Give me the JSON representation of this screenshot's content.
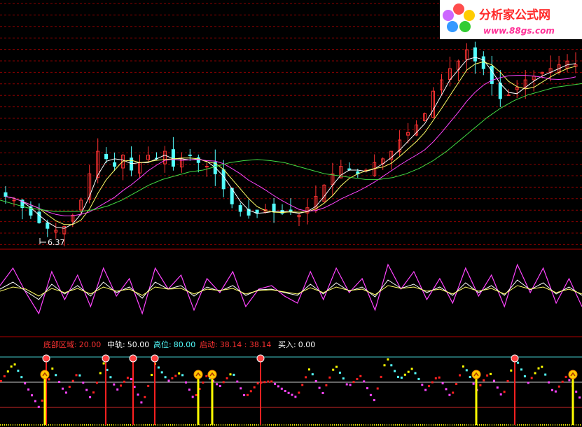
{
  "watermark": {
    "brand": "分析家公式网",
    "url": "www.88gs.com"
  },
  "chart_data": [
    {
      "type": "candlestick",
      "panel": "price",
      "low_label": "6.37",
      "colors": {
        "up": "#ff3232",
        "down": "#54ffff",
        "ma_white": "#ffffff",
        "ma_yellow": "#ffff66",
        "ma_magenta": "#ff44ff",
        "ma_green": "#44dd44"
      },
      "grid": true,
      "close": [
        7.4,
        7.3,
        7.1,
        6.9,
        6.7,
        6.55,
        6.5,
        6.6,
        6.9,
        7.3,
        8.0,
        8.6,
        8.4,
        8.2,
        8.5,
        8.1,
        8.3,
        8.5,
        8.4,
        8.6,
        8.2,
        8.4,
        8.5,
        8.3,
        8.2,
        8.0,
        7.6,
        7.2,
        7.0,
        6.9,
        6.95,
        7.05,
        7.0,
        6.95,
        7.0,
        6.9,
        7.1,
        7.4,
        7.7,
        8.0,
        8.2,
        8.1,
        8.0,
        8.1,
        8.3,
        8.4,
        8.6,
        8.9,
        9.1,
        9.3,
        9.6,
        10.2,
        10.5,
        10.8,
        11.0,
        11.3,
        11.0,
        10.8,
        10.4,
        10.0,
        10.1,
        10.3,
        10.5,
        10.6,
        10.7,
        10.8,
        10.9,
        11.0,
        10.9
      ],
      "ma_green_close": [
        7.3,
        7.2,
        7.1,
        7.05,
        7.0,
        7.0,
        7.0,
        7.05,
        7.15,
        7.3,
        7.5,
        7.7,
        7.85,
        7.95,
        8.05,
        8.1,
        8.2,
        8.3,
        8.35,
        8.38,
        8.35,
        8.3,
        8.2,
        8.1,
        8.0,
        7.95,
        7.9,
        7.85,
        7.85,
        7.9,
        8.0,
        8.15,
        8.35,
        8.6,
        8.9,
        9.2,
        9.5,
        9.75,
        9.95,
        10.1,
        10.2,
        10.3,
        10.35,
        10.4
      ]
    },
    {
      "type": "line",
      "panel": "oscillator",
      "series": [
        {
          "color": "#ff44ff",
          "values": [
            60,
            85,
            50,
            20,
            80,
            40,
            75,
            30,
            85,
            45,
            70,
            20,
            85,
            55,
            75,
            25,
            70,
            50,
            80,
            30,
            55,
            60,
            45,
            35,
            80,
            40,
            85,
            50,
            70,
            25,
            90,
            55,
            80,
            40,
            70,
            35,
            85,
            45,
            75,
            30,
            90,
            50,
            85,
            35,
            70,
            30
          ]
        },
        {
          "color": "#ffffff",
          "values": [
            55,
            65,
            52,
            40,
            62,
            48,
            60,
            45,
            65,
            50,
            58,
            42,
            65,
            55,
            60,
            45,
            58,
            52,
            60,
            46,
            54,
            55,
            50,
            46,
            62,
            48,
            64,
            52,
            58,
            44,
            68,
            56,
            62,
            50,
            58,
            46,
            64,
            50,
            60,
            46,
            68,
            54,
            64,
            48,
            58,
            46
          ]
        },
        {
          "color": "#ffff66",
          "values": [
            52,
            58,
            55,
            45,
            56,
            50,
            56,
            48,
            58,
            52,
            55,
            46,
            58,
            55,
            56,
            48,
            55,
            53,
            56,
            48,
            53,
            54,
            51,
            48,
            57,
            50,
            58,
            53,
            55,
            47,
            60,
            56,
            58,
            52,
            55,
            48,
            58,
            52,
            56,
            48,
            60,
            55,
            58,
            50,
            55,
            48
          ]
        }
      ]
    },
    {
      "type": "indicator",
      "panel": "signal",
      "legend": {
        "items": [
          {
            "label": "底部区域:",
            "value": "20.00",
            "color": "#ff3232"
          },
          {
            "label": "中轨:",
            "value": "50.00",
            "color": "#ffffff"
          },
          {
            "label": "高位:",
            "value": "80.00",
            "color": "#54ffff"
          },
          {
            "label": "启动:",
            "value": "38.14  :  38.14",
            "color": "#ff3232"
          },
          {
            "label": "买入:",
            "value": "0.00",
            "color": "#ffffff"
          }
        ]
      },
      "levels": [
        20,
        50,
        80
      ],
      "sell_signal_bars": [
        66,
        151,
        190,
        221,
        372,
        735
      ],
      "buy_signal_bars": [
        64,
        283,
        303,
        680,
        818
      ]
    }
  ]
}
